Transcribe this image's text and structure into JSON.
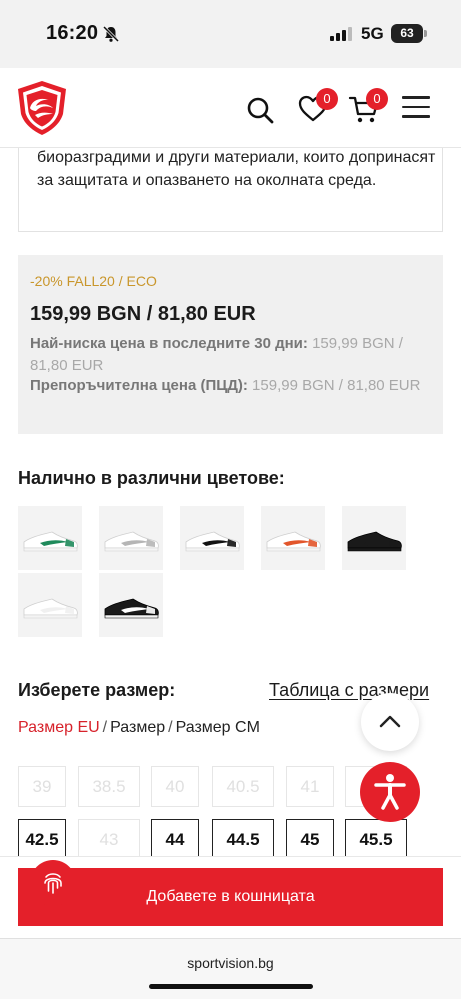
{
  "status_bar": {
    "time": "16:20",
    "network": "5G",
    "battery": "63"
  },
  "header": {
    "logo": "sportvision-logo",
    "wishlist_count": "0",
    "cart_count": "0"
  },
  "eco_description": "биоразградими и други материали, които допринасят за защитата и опазването на околната среда.",
  "price": {
    "promo_line": "-20% FALL20 / ECO",
    "current": "159,99 BGN / 81,80 EUR",
    "lowest_label": "Най-ниска цена в последните 30 дни:",
    "lowest_value": " 159,99 BGN / 81,80 EUR",
    "recommended_label": "Препоръчителна цена (ПЦД):",
    "recommended_value": " 159,99 BGN / 81,80 EUR"
  },
  "colors": {
    "title": "Налично в различни цветове:",
    "variants": [
      {
        "name": "white-green",
        "accent": "#1f8a5b",
        "body": "#ffffff"
      },
      {
        "name": "white-grey",
        "accent": "#b5b5b5",
        "body": "#ffffff"
      },
      {
        "name": "white-black",
        "accent": "#111111",
        "body": "#ffffff"
      },
      {
        "name": "white-orange",
        "accent": "#e2552a",
        "body": "#ffffff"
      },
      {
        "name": "all-black",
        "accent": "#1a1a1a",
        "body": "#1a1a1a"
      },
      {
        "name": "all-white",
        "accent": "#f0f0f0",
        "body": "#ffffff"
      },
      {
        "name": "black-white",
        "accent": "#ffffff",
        "body": "#1a1a1a"
      }
    ]
  },
  "size": {
    "title": "Изберете размер:",
    "table_link": "Таблица с размери",
    "systems": [
      "Размер EU",
      "Размер",
      "Размер CM"
    ],
    "sizes_row1": [
      {
        "label": "39",
        "available": false
      },
      {
        "label": "38.5",
        "available": false
      },
      {
        "label": "40",
        "available": false
      },
      {
        "label": "40.5",
        "available": false
      },
      {
        "label": "41",
        "available": false
      },
      {
        "label": "",
        "available": false
      }
    ],
    "sizes_row2": [
      {
        "label": "42.5",
        "available": true
      },
      {
        "label": "43",
        "available": false
      },
      {
        "label": "44",
        "available": true
      },
      {
        "label": "44.5",
        "available": true
      },
      {
        "label": "45",
        "available": true
      },
      {
        "label": "45.5",
        "available": true
      }
    ]
  },
  "cart_button": "Добавете в кошницата",
  "url": "sportvision.bg",
  "accent_color": "#e4202a"
}
